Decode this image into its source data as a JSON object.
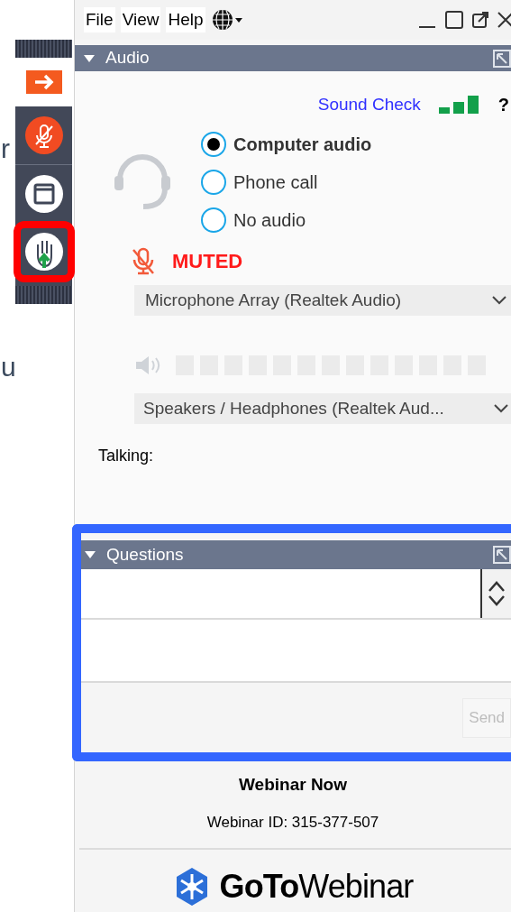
{
  "background_fragments": [
    "r",
    "u"
  ],
  "toolbar": {
    "items": [
      {
        "kind": "arrow",
        "highlighted": false
      },
      {
        "kind": "mic",
        "highlighted": false
      },
      {
        "kind": "window",
        "highlighted": false
      },
      {
        "kind": "hand",
        "highlighted": true
      }
    ]
  },
  "menu": [
    "File",
    "View",
    "Help"
  ],
  "audio": {
    "title": "Audio",
    "sound_check": "Sound Check",
    "help": "?",
    "options": [
      {
        "label": "Computer audio",
        "selected": true
      },
      {
        "label": "Phone call",
        "selected": false
      },
      {
        "label": "No audio",
        "selected": false
      }
    ],
    "mute_status": "MUTED",
    "microphone": "Microphone Array (Realtek Audio)",
    "speaker": "Speakers / Headphones (Realtek Aud...",
    "talking_label": "Talking:"
  },
  "questions": {
    "title": "Questions",
    "highlighted": true,
    "send": "Send",
    "send_disabled": true
  },
  "footer": {
    "title": "Webinar Now",
    "webinar_id": "Webinar ID: 315-377-507",
    "logo": "**GoTo**Webinar"
  }
}
